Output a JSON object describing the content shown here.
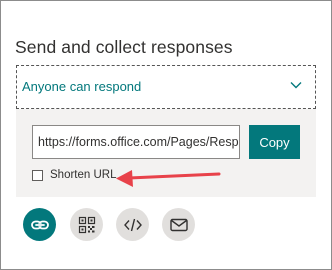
{
  "panel": {
    "title": "Send and collect responses",
    "audience_select": {
      "value": "Anyone can respond",
      "icon": "chevron-down-icon"
    }
  },
  "share_link": {
    "url": "https://forms.office.com/Pages/ResponsePage.aspx",
    "copy_label": "Copy",
    "shorten_url_label": "Shorten URL",
    "shorten_url_checked": false
  },
  "share_options": [
    {
      "name": "link-icon",
      "selected": true
    },
    {
      "name": "qr-code-icon",
      "selected": false
    },
    {
      "name": "embed-code-icon",
      "selected": false
    },
    {
      "name": "email-icon",
      "selected": false
    }
  ],
  "colors": {
    "accent": "#03787c",
    "arrow": "#e8424a",
    "panel_bg": "#f3f2f1",
    "icon_bg": "#e1dfdd"
  }
}
